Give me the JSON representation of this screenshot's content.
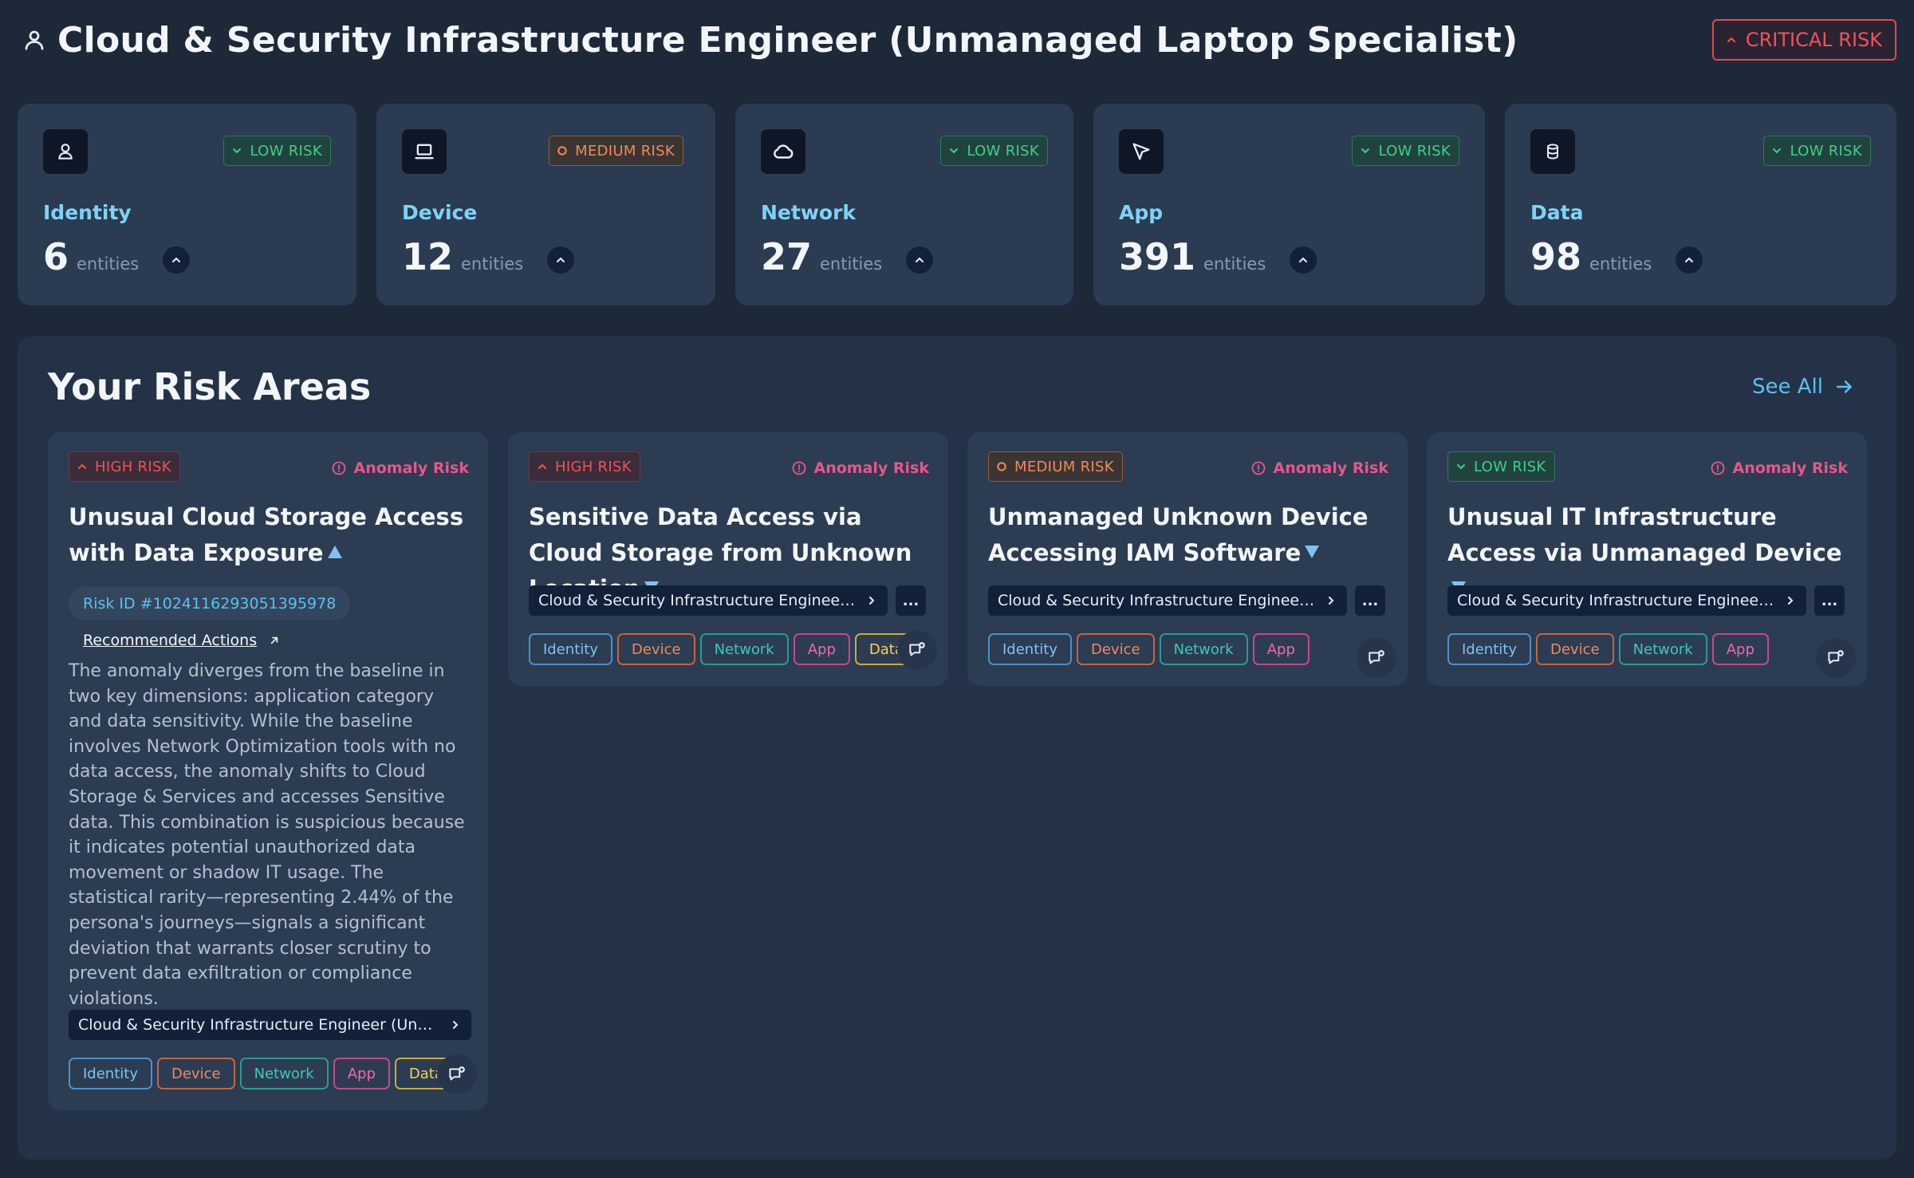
{
  "header": {
    "title": "Cloud & Security Infrastructure Engineer (Unmanaged Laptop Specialist)",
    "risk_label": "CRITICAL RISK",
    "icon": "user-icon"
  },
  "categories": [
    {
      "name": "Identity",
      "icon": "user-icon",
      "risk": "LOW RISK",
      "count": "6",
      "unit": "entities"
    },
    {
      "name": "Device",
      "icon": "laptop-icon",
      "risk": "MEDIUM RISK",
      "count": "12",
      "unit": "entities"
    },
    {
      "name": "Network",
      "icon": "cloud-icon",
      "risk": "LOW RISK",
      "count": "27",
      "unit": "entities"
    },
    {
      "name": "App",
      "icon": "cursor-icon",
      "risk": "LOW RISK",
      "count": "391",
      "unit": "entities"
    },
    {
      "name": "Data",
      "icon": "database-icon",
      "risk": "LOW RISK",
      "count": "98",
      "unit": "entities"
    }
  ],
  "risk_areas": {
    "title": "Your Risk Areas",
    "see_all": "See All",
    "cards": [
      {
        "risk": "HIGH RISK",
        "type": "Anomaly Risk",
        "title": "Unusual Cloud Storage Access with Data Exposure",
        "risk_id": "Risk ID #1024116293051395978",
        "recommended": "Recommended Actions",
        "description": "The anomaly diverges from the baseline in two key dimensions: application category and data sensitivity. While the baseline involves Network Optimization tools with no data access, the anomaly shifts to Cloud Storage & Services and accesses Sensitive data. This combination is suspicious because it indicates potential unauthorized data movement or shadow IT usage. The statistical rarity—representing 2.44% of the persona's journeys—signals a significant deviation that warrants closer scrutiny to prevent data exfiltration or compliance violations.",
        "persona": "Cloud & Security Infrastructure Engineer (Unmanaged Laptop Specialist)",
        "tags": [
          "Identity",
          "Device",
          "Network",
          "App",
          "Data"
        ]
      },
      {
        "risk": "HIGH RISK",
        "type": "Anomaly Risk",
        "title": "Sensitive Data Access via Cloud Storage from Unknown Location",
        "persona": "Cloud & Security Infrastructure Engineer (Unmanaged Laptop Specialist)",
        "more": "...",
        "tags": [
          "Identity",
          "Device",
          "Network",
          "App",
          "Data"
        ]
      },
      {
        "risk": "MEDIUM RISK",
        "type": "Anomaly Risk",
        "title": "Unmanaged Unknown Device Accessing IAM Software",
        "persona": "Cloud & Security Infrastructure Engineer (Unmanaged Laptop Specialist)",
        "more": "...",
        "tags": [
          "Identity",
          "Device",
          "Network",
          "App"
        ]
      },
      {
        "risk": "LOW RISK",
        "type": "Anomaly Risk",
        "title": "Unusual IT Infrastructure Access via Unmanaged Device",
        "persona": "Cloud & Security Infrastructure Engineer (Unmanaged Laptop Specialist)",
        "more": "...",
        "tags": [
          "Identity",
          "Device",
          "Network",
          "App"
        ]
      }
    ]
  },
  "colors": {
    "background": "#1d2939",
    "card": "#2b3b52",
    "accent": "#5bc0f0",
    "critical": "#f0525a",
    "low": "#3fcf8a",
    "medium": "#f08a5a",
    "anomaly": "#e8568a"
  }
}
